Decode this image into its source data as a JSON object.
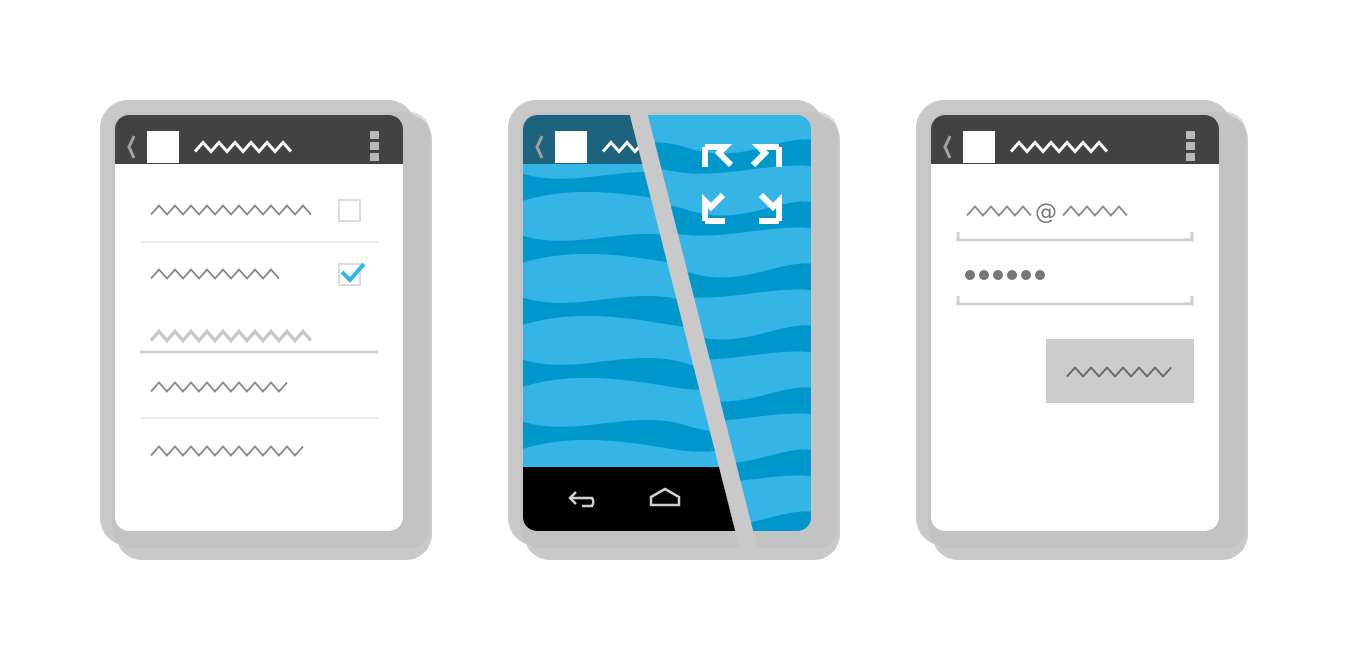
{
  "colors": {
    "background": "#ffffff",
    "device_frame": "#c9c9c9",
    "device_shadow": "#bdbdbd",
    "action_bar": "#424242",
    "screen": "#ffffff",
    "squiggle": "#888888",
    "squiggle_light": "#c8c8c8",
    "white_squiggle": "#ffffff",
    "accent_blue": "#33b5e5",
    "wave_light": "#35b4e6",
    "wave_dark": "#0098cc",
    "nav_bar": "#000000",
    "divider": "#e8e8e8",
    "button_gray": "#cccccc"
  },
  "icons": {
    "back_chevron": "chevron-left-icon",
    "app_logo": "app-logo-square",
    "overflow_menu": "overflow-menu-icon",
    "checkbox_empty": "checkbox-empty-icon",
    "checkbox_checked": "checkbox-checked-icon",
    "fullscreen": "fullscreen-expand-icon",
    "nav_back": "nav-back-icon",
    "nav_home": "nav-home-icon"
  },
  "devices": [
    {
      "name": "list-settings-phone",
      "list_items": [
        {
          "kind": "checkbox",
          "checked": false
        },
        {
          "kind": "checkbox",
          "checked": true
        },
        {
          "kind": "section-header"
        },
        {
          "kind": "plain"
        },
        {
          "kind": "plain"
        }
      ]
    },
    {
      "name": "fullscreen-immersive-phone",
      "show_nav_bar": true
    },
    {
      "name": "login-form-phone",
      "email_separator": "@",
      "password_dots": 6
    }
  ]
}
